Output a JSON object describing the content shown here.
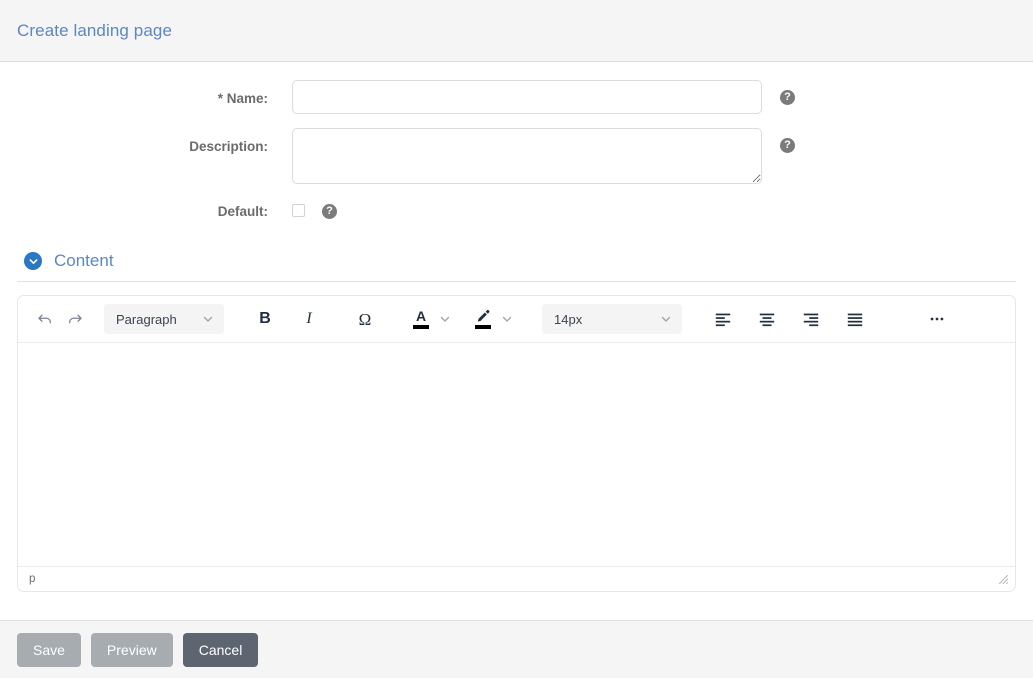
{
  "header": {
    "title": "Create landing page"
  },
  "form": {
    "name": {
      "label": "* Name:",
      "value": "",
      "placeholder": "",
      "help_icon": "help-circle-icon",
      "help_glyph": "?"
    },
    "description": {
      "label": "Description:",
      "value": "",
      "placeholder": "",
      "help_icon": "help-circle-icon",
      "help_glyph": "?"
    },
    "default": {
      "label": "Default:",
      "checked": false,
      "help_icon": "help-circle-icon",
      "help_glyph": "?"
    }
  },
  "content_section": {
    "title": "Content",
    "toggle_icon": "chevron-down-circle-icon",
    "expanded": true
  },
  "editor": {
    "toolbar": {
      "undo": {
        "label": "Undo",
        "icon": "undo-icon"
      },
      "redo": {
        "label": "Redo",
        "icon": "redo-icon"
      },
      "block_format": {
        "value": "Paragraph",
        "icon": "chevron-down-icon"
      },
      "bold": {
        "label": "B",
        "icon": "bold-icon"
      },
      "italic": {
        "label": "I",
        "icon": "italic-icon"
      },
      "special_char": {
        "label": "Ω",
        "icon": "omega-icon"
      },
      "text_color": {
        "label": "A",
        "icon": "text-color-icon",
        "swatch": "#000000",
        "caret_icon": "chevron-down-icon"
      },
      "highlight_color": {
        "icon": "highlight-pen-icon",
        "swatch": "#000000",
        "caret_icon": "chevron-down-icon"
      },
      "font_size": {
        "value": "14px",
        "icon": "chevron-down-icon"
      },
      "align_left": {
        "label": "Align left",
        "icon": "align-left-icon"
      },
      "align_center": {
        "label": "Align center",
        "icon": "align-center-icon"
      },
      "align_right": {
        "label": "Align right",
        "icon": "align-right-icon"
      },
      "align_justify": {
        "label": "Justify",
        "icon": "align-justify-icon"
      },
      "more": {
        "label": "More",
        "icon": "ellipsis-icon"
      }
    },
    "content": "",
    "status_path": "p",
    "resize_icon": "resize-grip-icon"
  },
  "footer": {
    "save": "Save",
    "preview": "Preview",
    "cancel": "Cancel"
  },
  "colors": {
    "title_blue": "#5b87c5",
    "accent_blue": "#2a78c4",
    "header_bg": "#f5f5f5",
    "button_muted": "#a6acb0",
    "button_dark": "#5d6670",
    "help_gray": "#7b7b7b",
    "toolbar_icon": "#222f3e"
  }
}
